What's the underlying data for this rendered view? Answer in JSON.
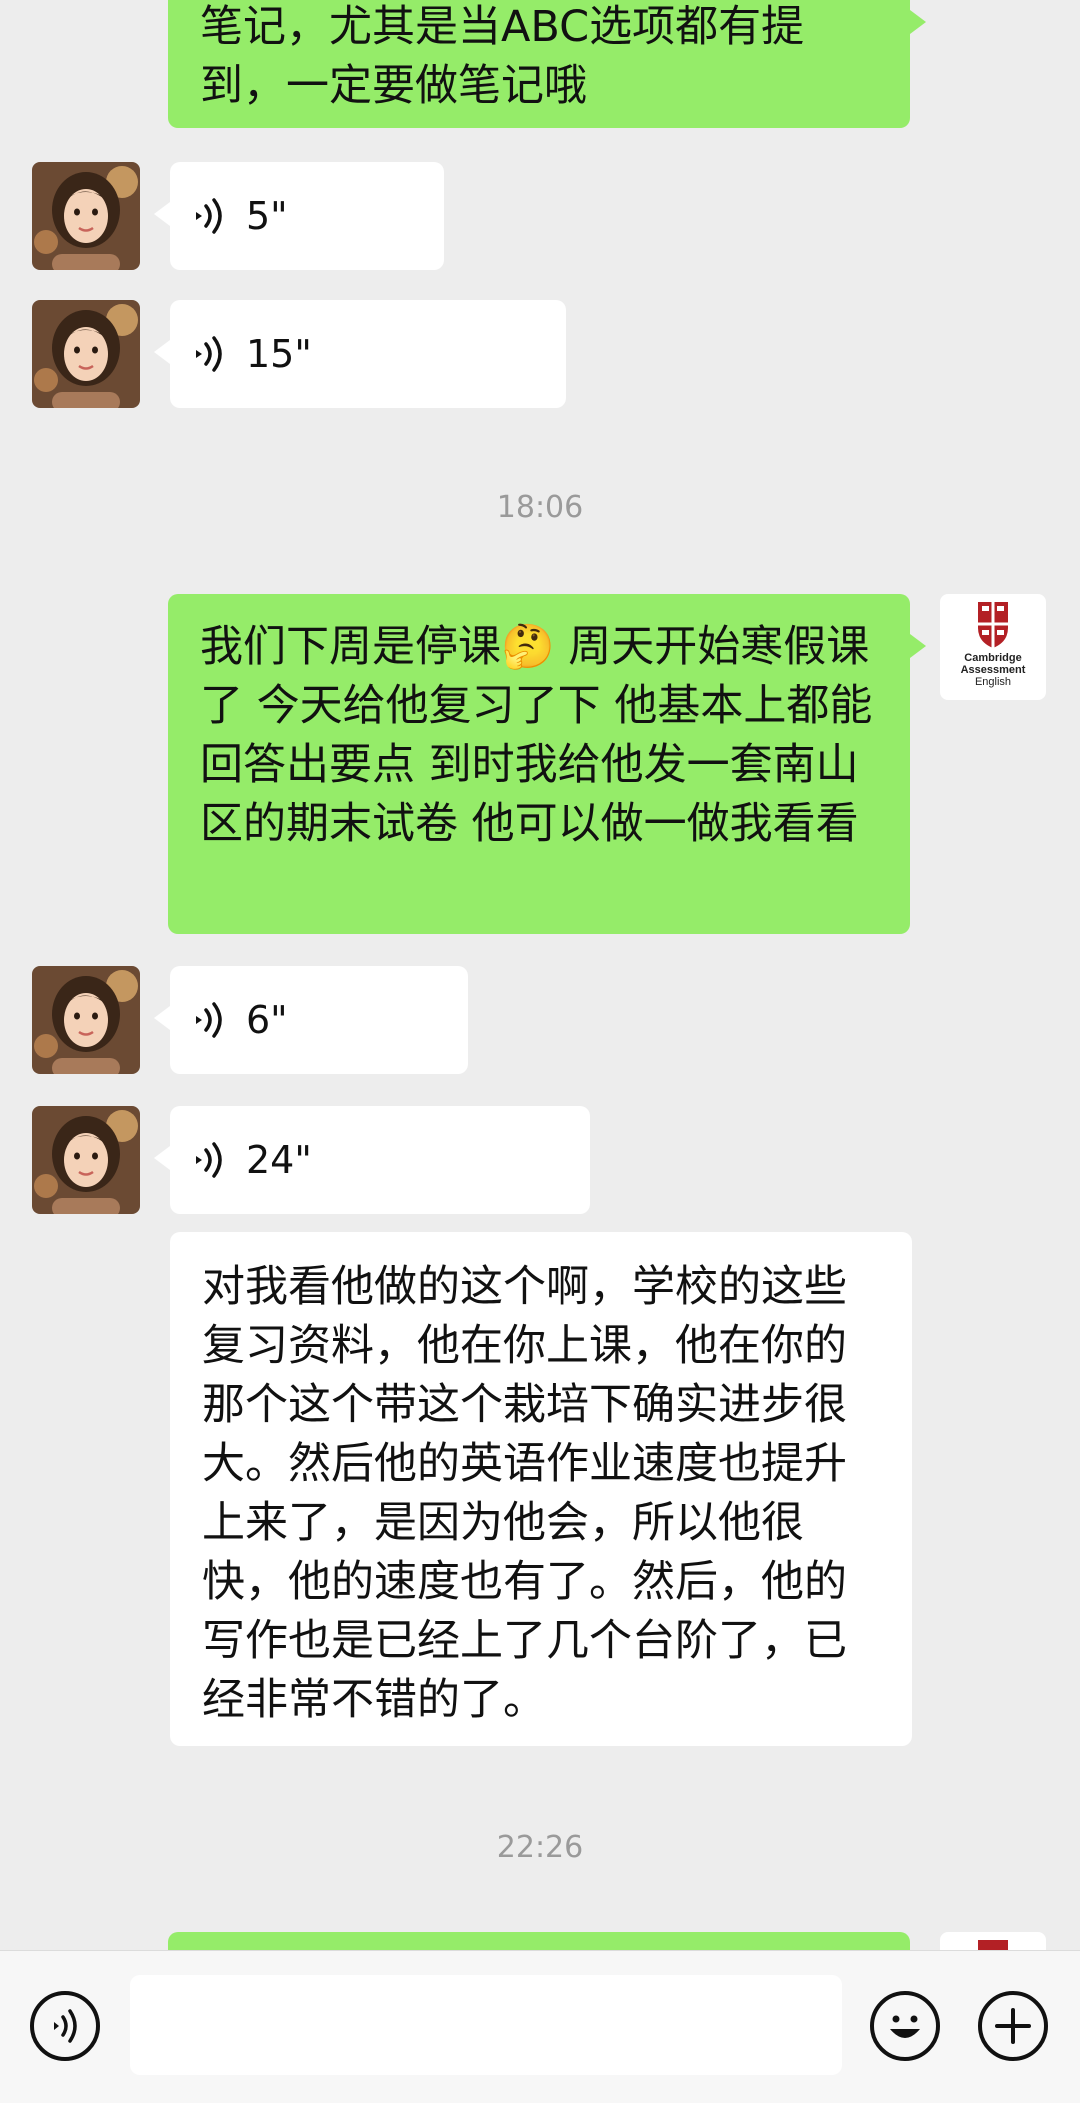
{
  "messages": {
    "m1_line1": "笔记，尤其是当ABC选项都有提",
    "m1_line2": "到，一定要做笔记哦",
    "voice1": "5\"",
    "voice2": "15\"",
    "time1": "18:06",
    "m2": "我们下周是停课🤔 周天开始寒假课了 今天给他复习了下 他基本上都能回答出要点 到时我给他发一套南山区的期末试卷 他可以做一做我看看",
    "voice3": "6\"",
    "voice4": "24\"",
    "m3": "对我看他做的这个啊，学校的这些复习资料，他在你上课，他在你的那个这个带这个栽培下确实进步很大。然后他的英语作业速度也提升上来了，是因为他会，所以他很快，他的速度也有了。然后，他的写作也是已经上了几个台阶了，已经非常不错的了。",
    "time2": "22:26"
  },
  "self_avatar": {
    "line1": "Cambridge",
    "line2": "Assessment",
    "line3": "English"
  },
  "colors": {
    "sent_bubble": "#95ec69",
    "received_bubble": "#ffffff",
    "background": "#ededed"
  },
  "icons": {
    "voice": "voice-wave-icon",
    "emoji": "smiley-icon",
    "plus": "plus-icon",
    "voice_input": "voice-input-icon"
  }
}
